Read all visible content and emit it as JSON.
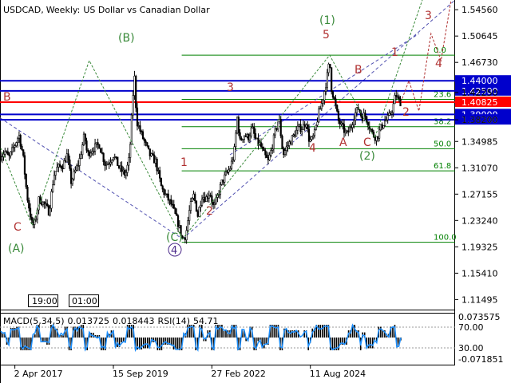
{
  "header": {
    "symbol": "USDCAD",
    "timeframe": "Weekly",
    "description": "US Dollar vs Canadian Dollar",
    "title_sep1": ",",
    "title_sep2": ":"
  },
  "time_tags": [
    "19:00",
    "01:00"
  ],
  "indicator": {
    "label": "MACD(5,34,5)",
    "value1": "0.013725",
    "value2": "0.018443",
    "rsi_label": "RSI(14)",
    "rsi_value": "54.71",
    "axis_labels": [
      "0.073575",
      "70.00",
      "30.00",
      "-0.071851"
    ]
  },
  "colors": {
    "candles": "#000000",
    "h_blue": "#0000cc",
    "h_red": "#ff0000",
    "fib": "#008000",
    "wave_green": "#3a8a3a",
    "wave_red": "#b03030",
    "wave_purple": "#4b2a8a",
    "channel": "#5050b0",
    "rsi": "#1e90ff",
    "price_tag": "#ff0000"
  },
  "chart_data": {
    "type": "candlestick",
    "y_ticks": [
      "1.54560",
      "1.50645",
      "1.46730",
      "1.42250",
      "1.38200",
      "1.34985",
      "1.31070",
      "1.27155",
      "1.23240",
      "1.19325",
      "1.15410",
      "1.11495"
    ],
    "x_ticks": [
      "2 Apr 2017",
      "15 Sep 2019",
      "27 Feb 2022",
      "11 Aug 2024"
    ],
    "price_labels": {
      "p1": "1.44000",
      "p2": "1.42500",
      "current": "1.40825",
      "p4": "1.39000",
      "p5": "1.38200"
    },
    "fib_labels": [
      "0.0",
      "23.6",
      "38.2",
      "50.0",
      "61.8",
      "100.0"
    ],
    "wave_labels": {
      "green": [
        "(B)",
        "(A)",
        "(C)",
        "(1)",
        "(2)"
      ],
      "red": [
        "B",
        "C",
        "1",
        "2",
        "3",
        "4",
        "5",
        "A",
        "B",
        "C",
        "1",
        "2",
        "3",
        "4"
      ],
      "purple": [
        "4"
      ]
    },
    "series": [
      {
        "name": "",
        "path": [
          [
            2016.9,
            1.328
          ],
          [
            2017.0,
            1.335
          ],
          [
            2017.1,
            1.325
          ],
          [
            2017.25,
            1.345
          ],
          [
            2017.35,
            1.36
          ],
          [
            2017.45,
            1.33
          ],
          [
            2017.55,
            1.27
          ],
          [
            2017.68,
            1.225
          ],
          [
            2017.75,
            1.228
          ],
          [
            2017.85,
            1.265
          ],
          [
            2018.0,
            1.255
          ],
          [
            2018.1,
            1.245
          ],
          [
            2018.22,
            1.3
          ],
          [
            2018.3,
            1.31
          ],
          [
            2018.45,
            1.315
          ],
          [
            2018.55,
            1.33
          ],
          [
            2018.65,
            1.29
          ],
          [
            2018.75,
            1.305
          ],
          [
            2018.85,
            1.32
          ],
          [
            2018.98,
            1.36
          ],
          [
            2019.05,
            1.33
          ],
          [
            2019.2,
            1.34
          ],
          [
            2019.35,
            1.345
          ],
          [
            2019.5,
            1.315
          ],
          [
            2019.6,
            1.32
          ],
          [
            2019.7,
            1.33
          ],
          [
            2019.85,
            1.31
          ],
          [
            2020.0,
            1.3
          ],
          [
            2020.1,
            1.325
          ],
          [
            2020.18,
            1.41
          ],
          [
            2020.22,
            1.45
          ],
          [
            2020.28,
            1.38
          ],
          [
            2020.4,
            1.36
          ],
          [
            2020.5,
            1.345
          ],
          [
            2020.6,
            1.33
          ],
          [
            2020.75,
            1.32
          ],
          [
            2020.9,
            1.28
          ],
          [
            2021.0,
            1.27
          ],
          [
            2021.15,
            1.255
          ],
          [
            2021.3,
            1.23
          ],
          [
            2021.42,
            1.205
          ],
          [
            2021.5,
            1.21
          ],
          [
            2021.6,
            1.25
          ],
          [
            2021.7,
            1.27
          ],
          [
            2021.8,
            1.24
          ],
          [
            2021.9,
            1.27
          ],
          [
            2022.0,
            1.265
          ],
          [
            2022.1,
            1.275
          ],
          [
            2022.2,
            1.25
          ],
          [
            2022.3,
            1.27
          ],
          [
            2022.4,
            1.29
          ],
          [
            2022.5,
            1.3
          ],
          [
            2022.6,
            1.31
          ],
          [
            2022.7,
            1.33
          ],
          [
            2022.78,
            1.385
          ],
          [
            2022.85,
            1.35
          ],
          [
            2022.95,
            1.36
          ],
          [
            2023.05,
            1.355
          ],
          [
            2023.15,
            1.37
          ],
          [
            2023.25,
            1.35
          ],
          [
            2023.35,
            1.345
          ],
          [
            2023.45,
            1.33
          ],
          [
            2023.55,
            1.32
          ],
          [
            2023.62,
            1.335
          ],
          [
            2023.75,
            1.37
          ],
          [
            2023.82,
            1.385
          ],
          [
            2023.92,
            1.33
          ],
          [
            2024.0,
            1.34
          ],
          [
            2024.1,
            1.35
          ],
          [
            2024.2,
            1.36
          ],
          [
            2024.3,
            1.37
          ],
          [
            2024.4,
            1.37
          ],
          [
            2024.5,
            1.38
          ],
          [
            2024.55,
            1.355
          ],
          [
            2024.62,
            1.35
          ],
          [
            2024.7,
            1.36
          ],
          [
            2024.8,
            1.39
          ],
          [
            2024.9,
            1.41
          ],
          [
            2025.0,
            1.44
          ],
          [
            2025.08,
            1.47
          ],
          [
            2025.12,
            1.43
          ],
          [
            2025.2,
            1.41
          ],
          [
            2025.3,
            1.38
          ],
          [
            2025.4,
            1.37
          ],
          [
            2025.5,
            1.36
          ],
          [
            2025.6,
            1.37
          ],
          [
            2025.7,
            1.39
          ],
          [
            2025.8,
            1.4
          ],
          [
            2025.88,
            1.385
          ],
          [
            2025.95,
            1.39
          ],
          [
            2026.05,
            1.375
          ],
          [
            2026.15,
            1.36
          ],
          [
            2026.25,
            1.355
          ],
          [
            2026.35,
            1.37
          ],
          [
            2026.45,
            1.38
          ],
          [
            2026.55,
            1.385
          ],
          [
            2026.65,
            1.4
          ],
          [
            2026.72,
            1.42
          ],
          [
            2026.8,
            1.41
          ],
          [
            2026.85,
            1.408
          ]
        ]
      }
    ],
    "ylim": [
      1.1,
      1.56
    ],
    "xlim": [
      2016.88,
      2028.2
    ]
  }
}
